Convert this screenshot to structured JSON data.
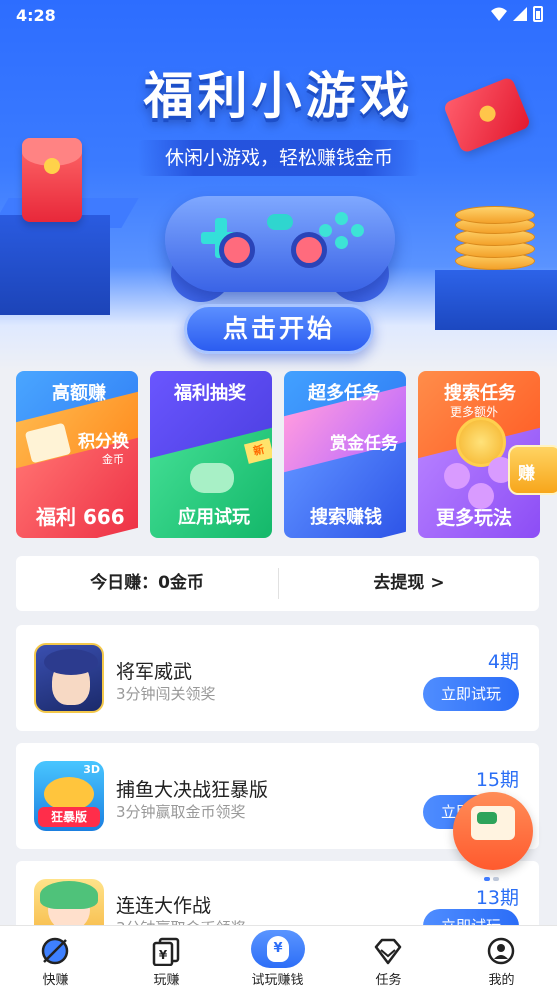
{
  "status_bar": {
    "time": "4:28"
  },
  "banner": {
    "title": "福利小游戏",
    "subtitle": "休闲小游戏，轻松赚钱金币",
    "start_button": "点击开始"
  },
  "feature_cards": [
    {
      "top_label": "高额赚",
      "mid_label": "积分换",
      "mid_sub": "金币",
      "bottom_label": "福利 666",
      "color": "#2f7cf5"
    },
    {
      "top_label": "福利抽奖",
      "badge": "新",
      "bottom_label": "应用试玩",
      "color": "#4b3ee0"
    },
    {
      "top_label": "超多任务",
      "mid_label": "赏金任务",
      "bottom_label": "搜索赚钱",
      "color": "#2f7af4"
    },
    {
      "top_label": "搜索任务",
      "top_sub": "更多额外",
      "bottom_label": "更多玩法",
      "color": "#ff5b24"
    }
  ],
  "floating_redpack_label": "赚",
  "earnings": {
    "today_label": "今日赚：0金币",
    "withdraw_label": "去提现 >"
  },
  "games": [
    {
      "name": "将军威武",
      "desc": "3分钟闯关领奖",
      "period": "4期",
      "button": "立即试玩"
    },
    {
      "name": "捕鱼大决战狂暴版",
      "desc": "3分钟赢取金币领奖",
      "period": "15期",
      "button": "立即试玩",
      "icon_tag": "狂暴版",
      "icon_badge": "3D"
    },
    {
      "name": "连连大作战",
      "desc": "3分钟赢取金币领奖",
      "period": "13期",
      "button": "立即试玩"
    }
  ],
  "bottom_nav": [
    {
      "label": "快赚",
      "icon": "rocket-icon"
    },
    {
      "label": "玩赚",
      "icon": "cards-icon"
    },
    {
      "label": "试玩赚钱",
      "icon": "money-bag-icon",
      "active": true,
      "icon_glyph": "¥"
    },
    {
      "label": "任务",
      "icon": "diamond-icon"
    },
    {
      "label": "我的",
      "icon": "user-icon"
    }
  ],
  "colors": {
    "accent": "#2d6ef7",
    "period_blue": "#2a6ef5",
    "page_bg": "#eef0f5"
  }
}
